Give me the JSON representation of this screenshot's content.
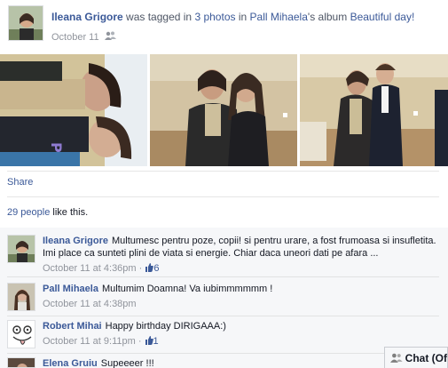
{
  "story": {
    "actor": "Ileana Grigore",
    "t1": "was tagged in",
    "photos_link": "3 photos",
    "t2": "in",
    "album_owner": "Pall Mihaela",
    "t3": "'s album",
    "album_name": "Beautiful day!",
    "date": "October 11",
    "audience_icon": "friends-icon"
  },
  "actions": {
    "share": "Share"
  },
  "likes": {
    "count_text": "29 people",
    "suffix": "like this."
  },
  "comments": [
    {
      "author": "Ileana Grigore",
      "text": "Multumesc pentru poze, copii! si pentru urare, a fost frumoasa si insufletita. Imi place ca sunteti plini de viata si energie. Chiar daca uneori dati pe afara ...",
      "time": "October 11 at 4:36pm",
      "likes": "6"
    },
    {
      "author": "Pall Mihaela",
      "text": "Multumim Doamna! Va iubimmmmmm !",
      "time": "October 11 at 4:38pm",
      "likes": ""
    },
    {
      "author": "Robert Mihai",
      "text": "Happy birthday DIRIGAAA:)",
      "time": "October 11 at 9:11pm",
      "likes": "1"
    },
    {
      "author": "Elena Gruiu",
      "text": "Supeeeer !!!",
      "time": "",
      "likes": ""
    }
  ],
  "chat": {
    "label": "Chat (Of"
  },
  "colors": {
    "link": "#3b5998",
    "muted": "#90949c",
    "comments_bg": "#f6f7f9"
  }
}
